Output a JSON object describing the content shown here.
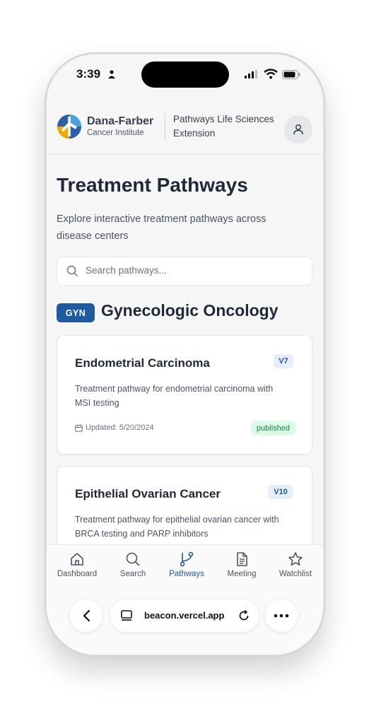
{
  "status_bar": {
    "time": "3:39"
  },
  "header": {
    "brand_name": "Dana-Farber",
    "brand_sub": "Cancer Institute",
    "extension_title": "Pathways Life Sciences Extension"
  },
  "page": {
    "title": "Treatment Pathways",
    "description": "Explore interactive treatment pathways across disease centers",
    "search_placeholder": "Search pathways..."
  },
  "section": {
    "badge": "GYN",
    "title": "Gynecologic Oncology"
  },
  "pathways": [
    {
      "title": "Endometrial Carcinoma",
      "version": "V7",
      "description": "Treatment pathway for endometrial carcinoma with MSI testing",
      "updated": "Updated: 5/20/2024",
      "status": "published"
    },
    {
      "title": "Epithelial Ovarian Cancer",
      "version": "V10",
      "description": "Treatment pathway for epithelial ovarian cancer with BRCA testing and PARP inhibitors"
    }
  ],
  "tabs": [
    {
      "label": "Dashboard",
      "icon": "home-icon"
    },
    {
      "label": "Search",
      "icon": "search-icon"
    },
    {
      "label": "Pathways",
      "icon": "branch-icon",
      "active": true
    },
    {
      "label": "Meeting",
      "icon": "document-icon"
    },
    {
      "label": "Watchlist",
      "icon": "star-icon"
    }
  ],
  "browser": {
    "url": "beacon.vercel.app"
  },
  "colors": {
    "accent": "#1e5aa0",
    "published_bg": "#dcfce7",
    "published_text": "#15803d"
  }
}
